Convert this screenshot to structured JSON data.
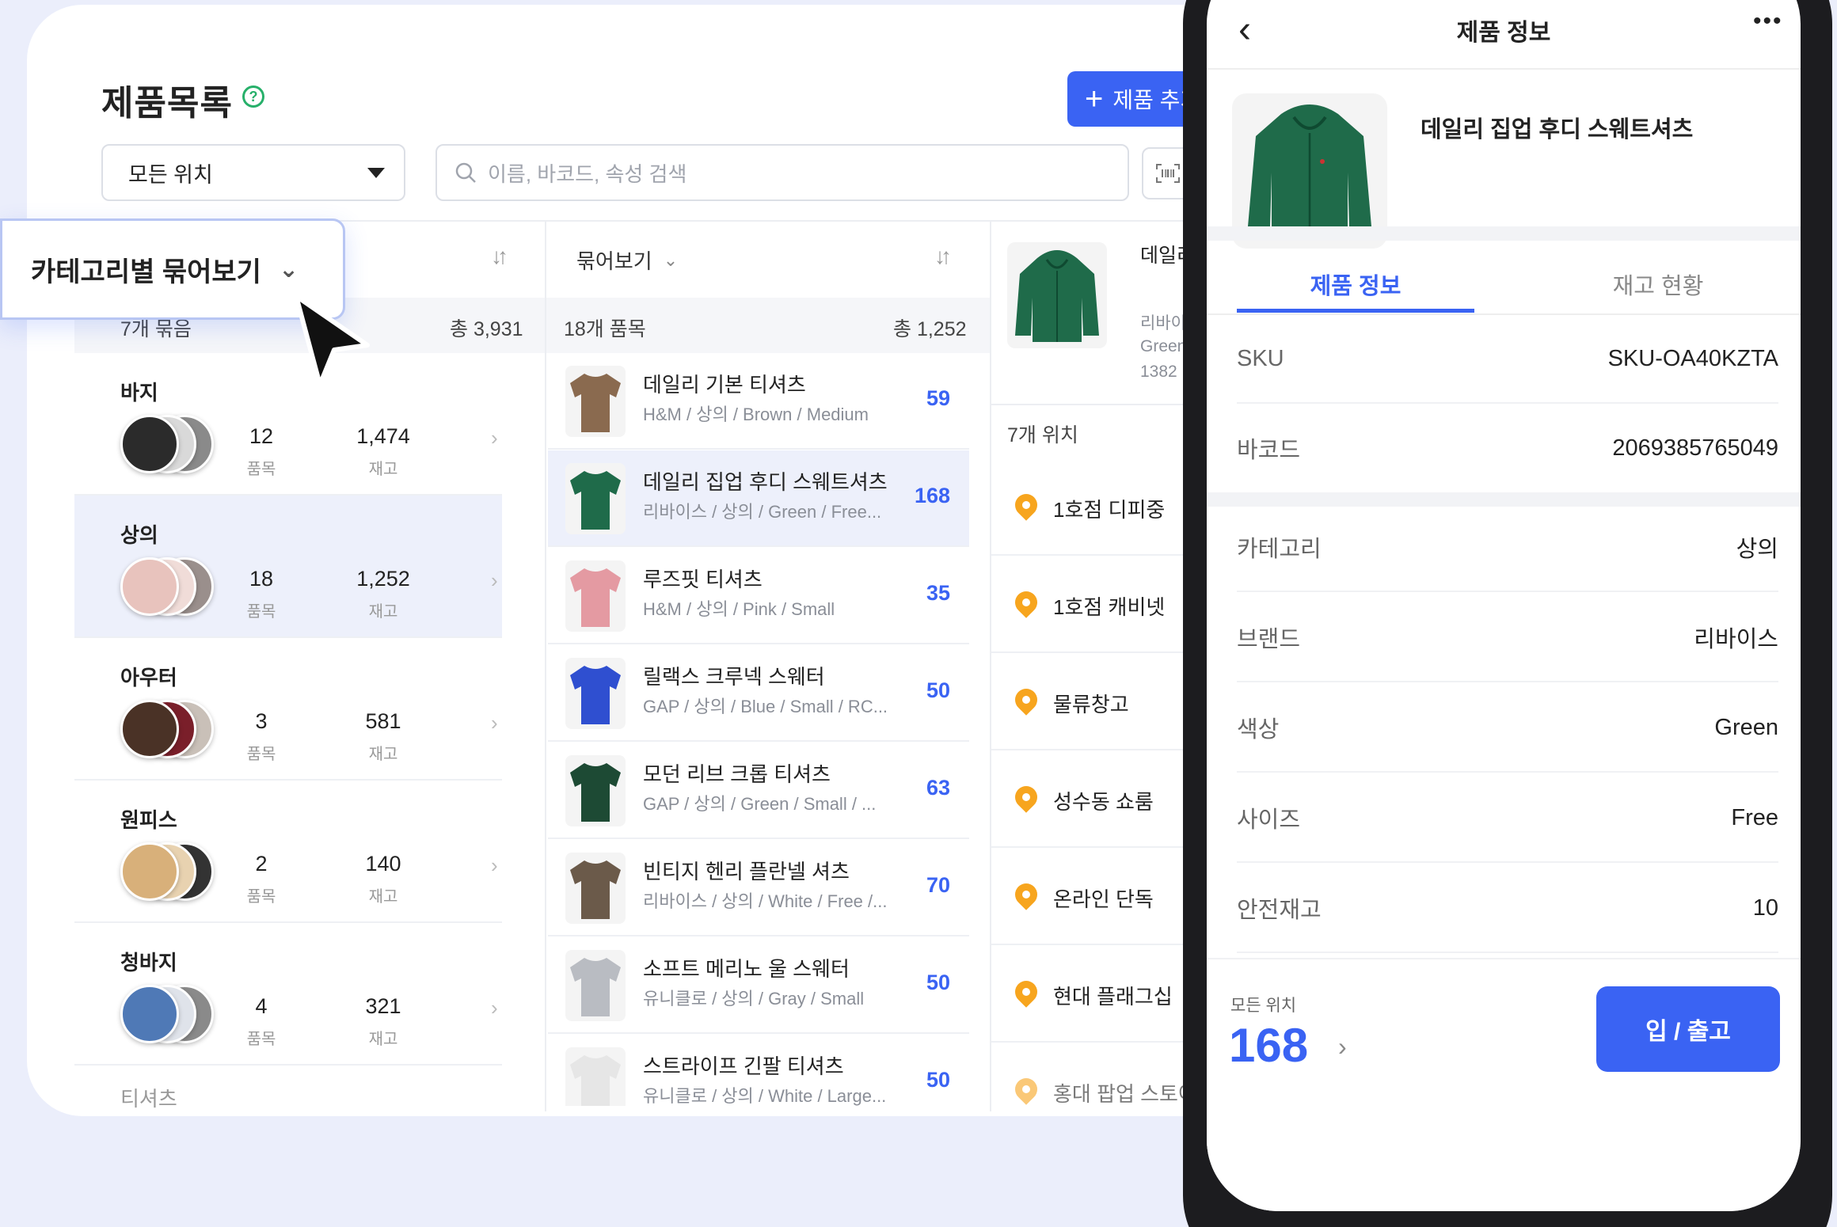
{
  "desktop": {
    "title": "제품목록",
    "add_button": "제품 추가",
    "location_select": "모든 위치",
    "search_placeholder": "이름, 바코드, 속성 검색",
    "category_column": {
      "header": "카테고리별 묶어보기",
      "count": "7개 묶음",
      "total": "총 3,931",
      "unit_items": "품목",
      "unit_stock": "재고",
      "rows": [
        {
          "name": "바지",
          "items": "12",
          "stock": "1,474",
          "colors": [
            "#2b2b2b",
            "#d9d9d9",
            "#8a8a8a"
          ]
        },
        {
          "name": "상의",
          "items": "18",
          "stock": "1,252",
          "colors": [
            "#e8c3bd",
            "#f0dcd8",
            "#9a8f8c"
          ]
        },
        {
          "name": "아우터",
          "items": "3",
          "stock": "581",
          "colors": [
            "#4a3226",
            "#7a1f2a",
            "#c9c0b8"
          ]
        },
        {
          "name": "원피스",
          "items": "2",
          "stock": "140",
          "colors": [
            "#d8b07a",
            "#e8d2b0",
            "#333333"
          ]
        },
        {
          "name": "청바지",
          "items": "4",
          "stock": "321",
          "colors": [
            "#4f79b6",
            "#dfe3ea",
            "#8a8a8a"
          ]
        },
        {
          "name": "티셔츠",
          "items": "",
          "stock": "",
          "colors": []
        }
      ]
    },
    "product_column": {
      "header": "묶어보기",
      "count": "18개 품목",
      "total": "총 1,252",
      "rows": [
        {
          "name": "데일리 기본 티셔츠",
          "sub": "H&M / 상의 / Brown / Medium",
          "qty": "59",
          "color": "#8a6a4f"
        },
        {
          "name": "데일리 집업 후디 스웨트셔츠",
          "sub": "리바이스 / 상의 / Green / Free...",
          "qty": "168",
          "color": "#1f6b4a"
        },
        {
          "name": "루즈핏 티셔츠",
          "sub": "H&M / 상의 / Pink / Small",
          "qty": "35",
          "color": "#e49aa2"
        },
        {
          "name": "릴랙스 크루넥 스웨터",
          "sub": "GAP / 상의 / Blue / Small / RC...",
          "qty": "50",
          "color": "#2f4fd0"
        },
        {
          "name": "모던 리브 크롭 티셔츠",
          "sub": "GAP / 상의 / Green / Small / ...",
          "qty": "63",
          "color": "#1d4a34"
        },
        {
          "name": "빈티지 헨리 플란넬 셔츠",
          "sub": "리바이스 / 상의 / White / Free /...",
          "qty": "70",
          "color": "#6b5a4a"
        },
        {
          "name": "소프트 메리노 울 스웨터",
          "sub": "유니클로 / 상의 / Gray / Small",
          "qty": "50",
          "color": "#b9bcc2"
        },
        {
          "name": "스트라이프 긴팔 티셔츠",
          "sub": "유니클로 / 상의 / White / Large...",
          "qty": "50",
          "color": "#e6e6e6"
        }
      ]
    },
    "location_column": {
      "product_name_partial": "데일리 집업 후디 스웨트셔츠",
      "product_sub_partial": "리바이스",
      "product_color_partial": "Green",
      "product_code_partial": "1382",
      "count": "7개 위치",
      "rows": [
        "1호점 디피중",
        "1호점 캐비넷",
        "물류창고",
        "성수동 쇼룸",
        "온라인 단독",
        "현대 플래그십",
        "홍대 팝업 스토어"
      ]
    }
  },
  "mobile": {
    "header_title": "제품 정보",
    "product_name": "데일리 집업 후디 스웨트셔츠",
    "tabs": [
      "제품 정보",
      "재고 현황"
    ],
    "fields": [
      {
        "key": "SKU",
        "value": "SKU-OA40KZTA"
      },
      {
        "key": "바코드",
        "value": "2069385765049"
      },
      {
        "key": "카테고리",
        "value": "상의"
      },
      {
        "key": "브랜드",
        "value": "리바이스"
      },
      {
        "key": "색상",
        "value": "Green"
      },
      {
        "key": "사이즈",
        "value": "Free"
      },
      {
        "key": "안전재고",
        "value": "10"
      }
    ],
    "footer_label": "모든 위치",
    "footer_qty": "168",
    "io_button": "입 / 출고"
  },
  "icons": {
    "help": "help-icon",
    "search": "search-icon",
    "barcode": "barcode-scan-icon",
    "sort": "sort-icon",
    "pin": "location-pin-icon",
    "back": "back-arrow-icon",
    "more": "more-icon",
    "cursor": "mouse-pointer-icon"
  },
  "colors": {
    "accent": "#3a63f3",
    "pin": "#f7a51e",
    "help": "#27b06a"
  }
}
